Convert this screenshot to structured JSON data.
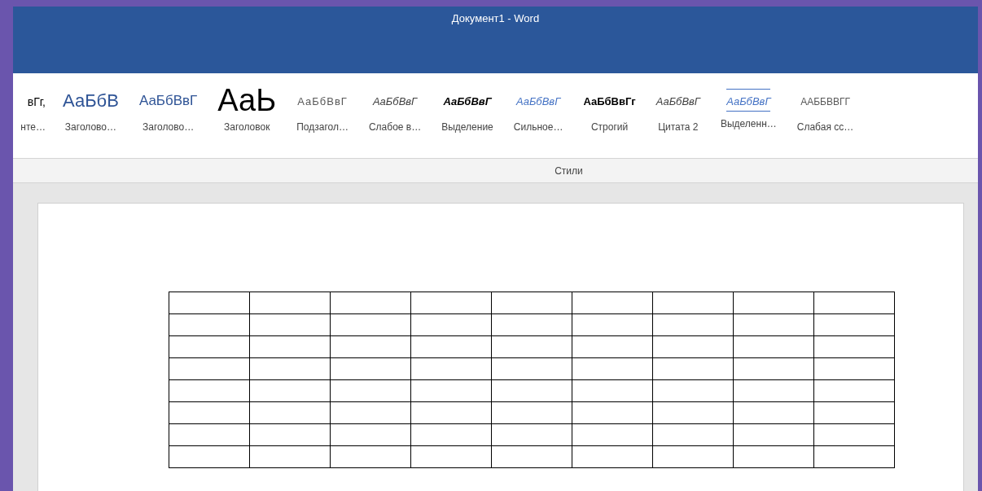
{
  "window": {
    "title": "Документ1  -  Word"
  },
  "styles_gallery": {
    "items": [
      {
        "kind": "normal",
        "preview": "вГг,",
        "name": "нте…"
      },
      {
        "kind": "heading1",
        "preview": "АаБбВ",
        "name": "Заголово…"
      },
      {
        "kind": "heading2",
        "preview": "АаБбВвГ",
        "name": "Заголово…"
      },
      {
        "kind": "title",
        "preview": "АаЬ",
        "name": "Заголовок"
      },
      {
        "kind": "subtitle",
        "preview": "АаБбВвГ",
        "name": "Подзагол…"
      },
      {
        "kind": "subtle",
        "preview": "АаБбВвГ",
        "name": "Слабое в…"
      },
      {
        "kind": "emphasis",
        "preview": "АаБбВвГ",
        "name": "Выделение"
      },
      {
        "kind": "intense",
        "preview": "АаБбВвГ",
        "name": "Сильное…"
      },
      {
        "kind": "strong",
        "preview": "АаБбВвГг",
        "name": "Строгий"
      },
      {
        "kind": "quote",
        "preview": "АаБбВвГ",
        "name": "Цитата 2"
      },
      {
        "kind": "intense-quote",
        "preview": "АаБбВвГ",
        "name": "Выделенн…"
      },
      {
        "kind": "subtle-ref",
        "preview": "ААББВВГГ",
        "name": "Слабая сс…"
      }
    ],
    "group_label": "Стили"
  }
}
